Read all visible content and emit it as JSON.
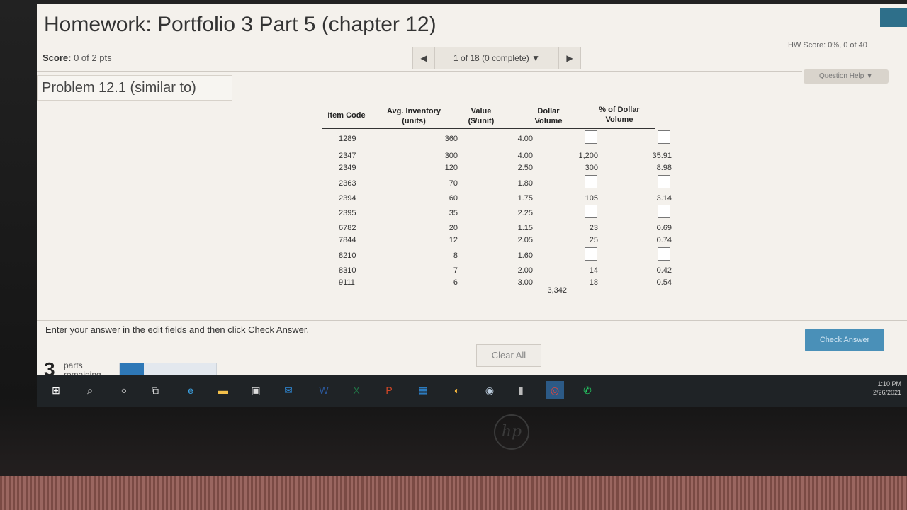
{
  "header": {
    "title": "Homework: Portfolio 3 Part 5 (chapter 12)",
    "score_label": "Score:",
    "score_value": "0 of 2 pts",
    "hw_score": "HW Score: 0%, 0 of 40",
    "nav_text": "1 of 18 (0 complete) ▼",
    "question_help": "Question Help ▼",
    "problem": "Problem 12.1 (similar to)"
  },
  "table": {
    "headers": {
      "item_code": "Item Code",
      "avg_inventory": "Avg. Inventory\n(units)",
      "value": "Value\n($/unit)",
      "dollar_volume": "Dollar\nVolume",
      "pct_dollar_volume": "% of Dollar\nVolume"
    },
    "rows": [
      {
        "code": "1289",
        "inv": "360",
        "val": "4.00",
        "dv": "",
        "pct": ""
      },
      {
        "code": "2347",
        "inv": "300",
        "val": "4.00",
        "dv": "1,200",
        "pct": "35.91"
      },
      {
        "code": "2349",
        "inv": "120",
        "val": "2.50",
        "dv": "300",
        "pct": "8.98"
      },
      {
        "code": "2363",
        "inv": "70",
        "val": "1.80",
        "dv": "",
        "pct": ""
      },
      {
        "code": "2394",
        "inv": "60",
        "val": "1.75",
        "dv": "105",
        "pct": "3.14"
      },
      {
        "code": "2395",
        "inv": "35",
        "val": "2.25",
        "dv": "",
        "pct": ""
      },
      {
        "code": "6782",
        "inv": "20",
        "val": "1.15",
        "dv": "23",
        "pct": "0.69"
      },
      {
        "code": "7844",
        "inv": "12",
        "val": "2.05",
        "dv": "25",
        "pct": "0.74"
      },
      {
        "code": "8210",
        "inv": "8",
        "val": "1.60",
        "dv": "",
        "pct": ""
      },
      {
        "code": "8310",
        "inv": "7",
        "val": "2.00",
        "dv": "14",
        "pct": "0.42"
      },
      {
        "code": "9111",
        "inv": "6",
        "val": "3.00",
        "dv": "18",
        "pct": "0.54"
      }
    ],
    "total_dollar_volume": "3,342"
  },
  "footer": {
    "instruction": "Enter your answer in the edit fields and then click Check Answer.",
    "clear_all": "Clear All",
    "check_answer": "Check Answer",
    "parts_count": "3",
    "parts_label_1": "parts",
    "parts_label_2": "remaining",
    "progress_fraction": 0.25
  },
  "taskbar": {
    "icons": [
      "windows-icon",
      "search-icon",
      "cortana-icon",
      "task-view-icon",
      "edge-icon",
      "file-explorer-icon",
      "store-icon",
      "mail-icon",
      "word-icon",
      "excel-icon",
      "powerpoint-icon",
      "calendar-icon",
      "weather-icon",
      "camera-icon",
      "usb-icon",
      "chrome-icon",
      "whatsapp-icon"
    ],
    "clock_time": "1:10 PM",
    "clock_date": "2/26/2021"
  },
  "brand": "hp",
  "colors": {
    "accent": "#2e78b7",
    "check_button": "#4a90b8"
  }
}
